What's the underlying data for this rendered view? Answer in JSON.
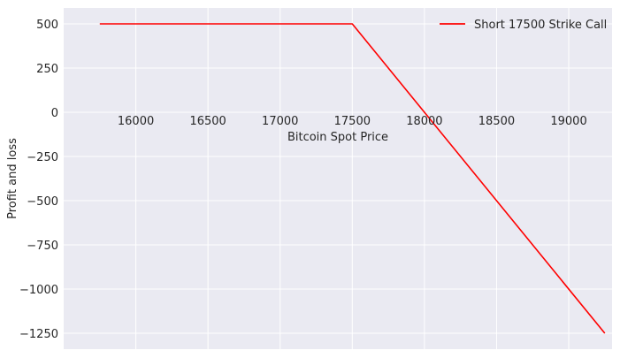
{
  "chart_data": {
    "type": "line",
    "xlabel": "Bitcoin Spot Price",
    "ylabel": "Profit and loss",
    "xlim": [
      15500,
      19300
    ],
    "ylim": [
      -1340,
      590
    ],
    "x_ticks": [
      16000,
      16500,
      17000,
      17500,
      18000,
      18500,
      19000
    ],
    "y_ticks": [
      500,
      250,
      0,
      -250,
      -500,
      -750,
      -1000,
      -1250
    ],
    "y_tick_labels": [
      "500",
      "250",
      "0",
      "−250",
      "−500",
      "−750",
      "−1000",
      "−1250"
    ],
    "grid": true,
    "legend_position": "top-right",
    "series": [
      {
        "name": "Short 17500 Strike Call",
        "color": "#ff0000",
        "x": [
          15750,
          17500,
          19250
        ],
        "y": [
          500,
          500,
          -1250
        ]
      }
    ]
  }
}
